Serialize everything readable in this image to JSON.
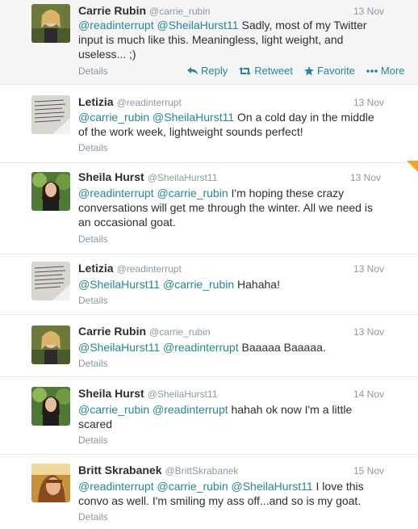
{
  "accent": "#22879a",
  "tweets": [
    {
      "name": "Carrie Rubin",
      "handle": "@carrie_rubin",
      "date": "13 Nov",
      "avatar": "carrie",
      "mentions": "@readinterrupt @SheilaHurst11",
      "body": " Sadly, most of my Twitter input is much like this. Meaningless, light weight, and useless... ;)",
      "details": "Details",
      "actions": {
        "reply": "Reply",
        "retweet": "Retweet",
        "favorite": "Favorite",
        "more": "More"
      }
    },
    {
      "name": "Letizia",
      "handle": "@readinterrupt",
      "date": "13 Nov",
      "avatar": "letizia",
      "mentions": "@carrie_rubin @SheilaHurst11",
      "body": " On a cold day in the middle of the work week, lightweight sounds perfect!",
      "details": "Details"
    },
    {
      "name": "Sheila Hurst",
      "handle": "@SheilaHurst11",
      "date": "13 Nov",
      "avatar": "sheila",
      "mentions": "@readinterrupt @carrie_rubin",
      "body": " I'm hoping these crazy conversations will get me through the winter. All we need is an occasional goat.",
      "details": "Details"
    },
    {
      "name": "Letizia",
      "handle": "@readinterrupt",
      "date": "13 Nov",
      "avatar": "letizia",
      "mentions": "@SheilaHurst11 @carrie_rubin",
      "body": " Hahaha!",
      "details": "Details"
    },
    {
      "name": "Carrie Rubin",
      "handle": "@carrie_rubin",
      "date": "13 Nov",
      "avatar": "carrie",
      "mentions": "@SheilaHurst11 @readinterrupt",
      "body": " Baaaaa Baaaaa.",
      "details": "Details"
    },
    {
      "name": "Sheila Hurst",
      "handle": "@SheilaHurst11",
      "date": "14 Nov",
      "avatar": "sheila",
      "mentions": "@carrie_rubin @readinterrupt",
      "body": " hahah ok now I'm a little scared",
      "details": "Details"
    },
    {
      "name": "Britt Skrabanek",
      "handle": "@BrittSkrabanek",
      "date": "15 Nov",
      "avatar": "britt",
      "mentions": "@readinterrupt @carrie_rubin @SheilaHurst11",
      "body": " I love this convo as well. I'm smiling my ass off...and so is my goat.",
      "details": "Details"
    }
  ]
}
